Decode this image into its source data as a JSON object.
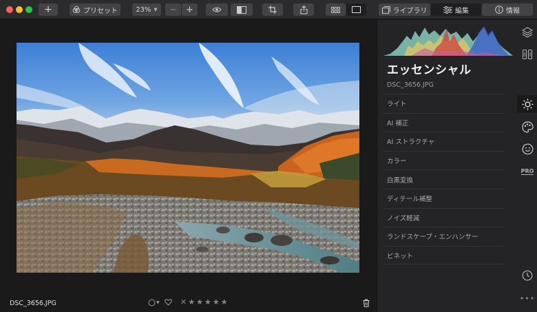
{
  "toolbar": {
    "add_label": "+",
    "presets_label": "プリセット",
    "zoom_label": "23%",
    "zoom_out_label": "−",
    "zoom_in_label": "+",
    "library_label": "ライブラリ",
    "edit_label": "編集",
    "info_label": "情報"
  },
  "canvas": {
    "filename": "DSC_3656.JPG",
    "rating_reject": "✕",
    "stars": [
      "★",
      "★",
      "★",
      "★",
      "★"
    ]
  },
  "panel": {
    "title": "エッセンシャル",
    "filename": "DSC_3656.JPG",
    "tools": [
      {
        "label": "ライト"
      },
      {
        "label": "AI 補正"
      },
      {
        "label": "AI ストラクチャ"
      },
      {
        "label": "カラー"
      },
      {
        "label": "白黒変換"
      },
      {
        "label": "ディテール補整"
      },
      {
        "label": "ノイズ軽減"
      },
      {
        "label": "ランドスケープ・エンハンサー"
      },
      {
        "label": "ビネット"
      }
    ],
    "side_pro_label": "PRO",
    "more_label": "•••"
  },
  "colors": {
    "toolbar_bg": "#2b2b2d",
    "canvas_bg": "#1a1a1b",
    "panel_bg": "#242426",
    "sky_top": "#3d7fd6",
    "autumn_orange": "#c8621c"
  }
}
